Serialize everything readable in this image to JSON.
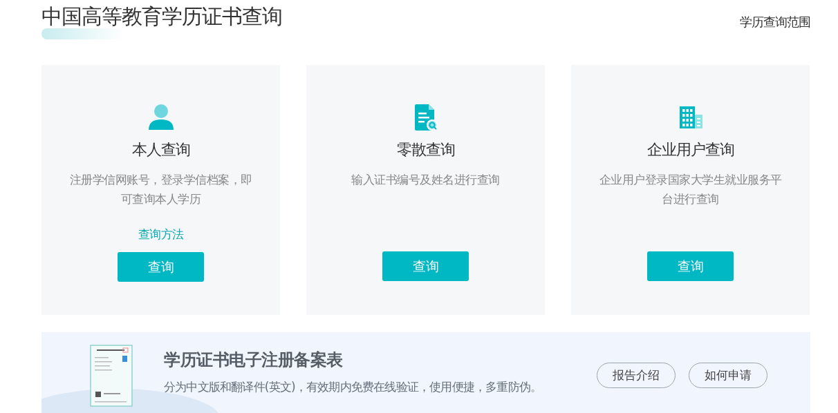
{
  "page": {
    "title": "中国高等教育学历证书查询",
    "scope_link": "学历查询范围"
  },
  "cards": [
    {
      "kind": "person",
      "title": "本人查询",
      "description": "注册学信网账号，登录学信档案，即可查询本人学历",
      "link": "查询方法",
      "button": "查询"
    },
    {
      "kind": "document",
      "title": "零散查询",
      "description": "输入证书编号及姓名进行查询",
      "button": "查询"
    },
    {
      "kind": "building",
      "title": "企业用户查询",
      "description": "企业用户登录国家大学生就业服务平台进行查询",
      "button": "查询"
    }
  ],
  "banner": {
    "title": "学历证书电子注册备案表",
    "description": "分为中文版和翻译件(英文)，有效期内免费在线验证，使用便捷，多重防伪。",
    "buttons": [
      "报告介绍",
      "如何申请"
    ]
  }
}
